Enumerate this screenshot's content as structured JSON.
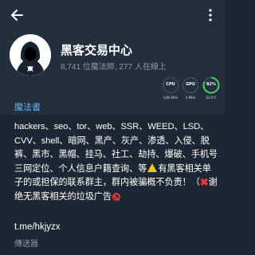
{
  "header": {
    "title": "黑客交易中心",
    "subtitle": "8,741 位魔法師, 277 人在線上",
    "back_icon": "arrow-left-icon",
    "more_icon": "vertical-dots-icon"
  },
  "status_widgets": [
    {
      "label": "CPU",
      "sub": "1/60 MHz",
      "value": null,
      "color": "#3a4552"
    },
    {
      "label": "GPU",
      "sub": "0 MHz",
      "value": null,
      "color": "#3a4552"
    },
    {
      "label": "82%",
      "sub": "33.0°C",
      "value": 82,
      "color": "#43d35a"
    }
  ],
  "info": {
    "section_label": "魔法書",
    "description": {
      "part1": "hackers、seo、tor、web、SSR、WEED、LSD、CVV、shell、暗网、黑产、灰产、渗透、入侵、脱裤、黑市、黑帽、挂马、社工、劫持、爆破、手机号三网定位、个人信息户籍查询、等",
      "part2": "有黑客相关单子的或担保的联系群主，群内被骗概不负责！（",
      "part3": "谢绝无黑客相关的垃圾广告"
    },
    "link": "t.me/hkjyzx",
    "link_caption": "傳送器"
  },
  "colors": {
    "background": "#1d2733",
    "header": "#232f3d",
    "accent": "#64b5ef",
    "muted": "#8d98a5"
  }
}
